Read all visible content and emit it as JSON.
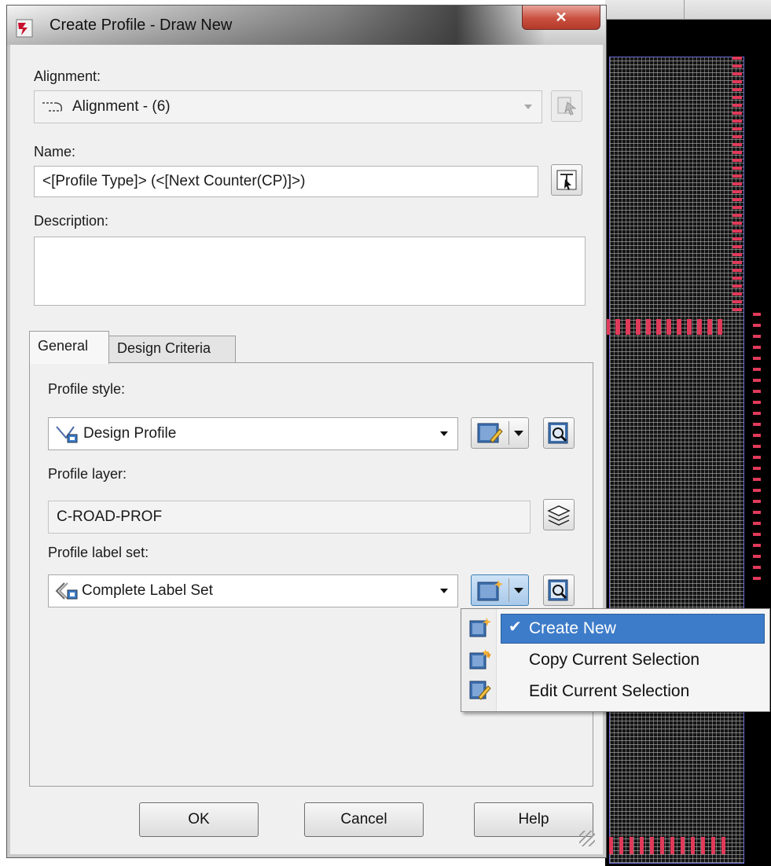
{
  "window": {
    "title": "Create Profile - Draw New",
    "close_glyph": "✕"
  },
  "alignment": {
    "label": "Alignment:",
    "value": "Alignment - (6)",
    "icon": "alignment-icon"
  },
  "name": {
    "label": "Name:",
    "value": "<[Profile Type]> (<[Next Counter(CP)]>)"
  },
  "description": {
    "label": "Description:",
    "value": ""
  },
  "tabs": [
    {
      "label": "General",
      "active": true
    },
    {
      "label": "Design Criteria",
      "active": false
    }
  ],
  "general": {
    "profile_style": {
      "label": "Profile style:",
      "value": "Design Profile",
      "icon": "profile-style-icon"
    },
    "profile_layer": {
      "label": "Profile layer:",
      "value": "C-ROAD-PROF"
    },
    "profile_label_set": {
      "label": "Profile label set:",
      "value": "Complete Label Set",
      "icon": "label-set-icon"
    }
  },
  "dropdown_menu": {
    "items": [
      {
        "label": "Create New",
        "checked": true,
        "highlighted": true,
        "icon": "create-new-icon"
      },
      {
        "label": "Copy Current Selection",
        "checked": false,
        "highlighted": false,
        "icon": "copy-selection-icon"
      },
      {
        "label": "Edit Current Selection",
        "checked": false,
        "highlighted": false,
        "icon": "edit-selection-icon"
      }
    ]
  },
  "buttons": {
    "ok": "OK",
    "cancel": "Cancel",
    "help": "Help"
  },
  "colors": {
    "menu_highlight": "#3d7cc9",
    "close_button": "#c9503f",
    "cad_background": "#000000",
    "cad_markers": "#e03a5a"
  }
}
